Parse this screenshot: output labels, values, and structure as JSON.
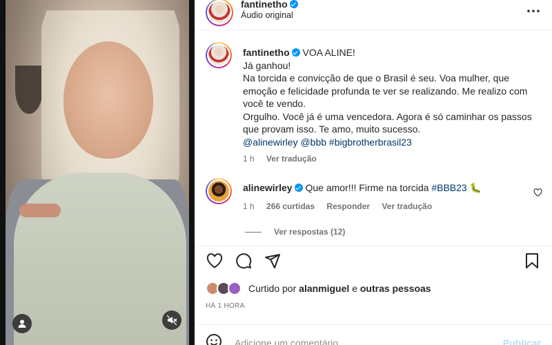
{
  "post": {
    "author": "fantinetho",
    "audio": "Áudio original",
    "more_icon": "more-horizontal-icon"
  },
  "caption": {
    "username": "fantinetho",
    "headline": "VOA ALINE!",
    "lines": [
      "Já ganhou!",
      "Na torcida e convicção de que o Brasil é seu. Voa mulher, que emoção e felicidade profunda te ver se realizando. Me realizo com você te vendo.",
      "Orgulho. Você já é uma vencedora. Agora é só caminhar os passos que provam isso. Te amo, muito sucesso."
    ],
    "tags": "@alinewirley @bbb #bigbrotherbrasil23",
    "time": "1 h",
    "translate": "Ver tradução"
  },
  "comment": {
    "username": "alinewirley",
    "text": "Que amor!!! Firme na torcida",
    "hashtag": "#BBB23",
    "emoji": "🐛",
    "time": "1 h",
    "likes": "266 curtidas",
    "reply": "Responder",
    "translate": "Ver tradução",
    "view_replies": "Ver respostas (12)"
  },
  "likes": {
    "prefix": "Curtido por",
    "user": "alanmiguel",
    "connector": "e",
    "others": "outras pessoas"
  },
  "timestamp": "HÁ 1 HORA",
  "add_comment": {
    "placeholder": "Adicione um comentário...",
    "publish": "Publicar"
  },
  "colors": {
    "verified": "#0095f6",
    "link": "#00376b",
    "muted": "#737373",
    "publish_disabled": "#b2dffc"
  }
}
